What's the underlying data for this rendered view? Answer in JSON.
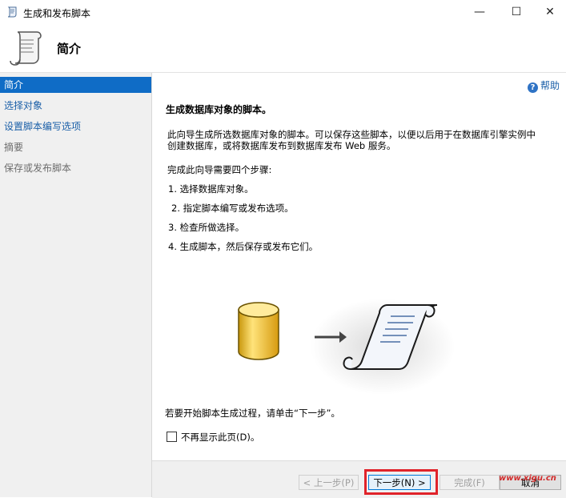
{
  "window": {
    "title": "生成和发布脚本",
    "minimize": "—",
    "maximize": "☐",
    "close": "✕"
  },
  "header": {
    "title": "简介",
    "icon": "script-scroll-icon"
  },
  "sidebar": {
    "items": [
      {
        "label": "简介",
        "state": "active"
      },
      {
        "label": "选择对象",
        "state": "link"
      },
      {
        "label": "设置脚本编写选项",
        "state": "link"
      },
      {
        "label": "摘要",
        "state": "disabled"
      },
      {
        "label": "保存或发布脚本",
        "state": "disabled"
      }
    ]
  },
  "main": {
    "help_label": "帮助",
    "heading": "生成数据库对象的脚本。",
    "description_line1": "此向导生成所选数据库对象的脚本。可以保存这些脚本，以便以后用于在数据库引擎实例中",
    "description_line2": "创建数据库，或将数据库发布到数据库发布 Web 服务。",
    "steps_intro": "完成此向导需要四个步骤:",
    "steps": [
      "1.  选择数据库对象。",
      "2.  指定脚本编写或发布选项。",
      "3.  检查所做选择。",
      "4.  生成脚本，然后保存或发布它们。"
    ],
    "start_text": "若要开始脚本生成过程，请单击“下一步”。",
    "dont_show_label": "不再显示此页(D)。"
  },
  "footer": {
    "prev_label": "< 上一步(P)",
    "next_label": "下一步(N) >",
    "finish_label": "完成(F)",
    "cancel_label": "取消",
    "watermark": "www.xigu.cn"
  },
  "colors": {
    "accent": "#0f6cc6",
    "link": "#1a5fa8",
    "highlight": "#e0232a"
  }
}
